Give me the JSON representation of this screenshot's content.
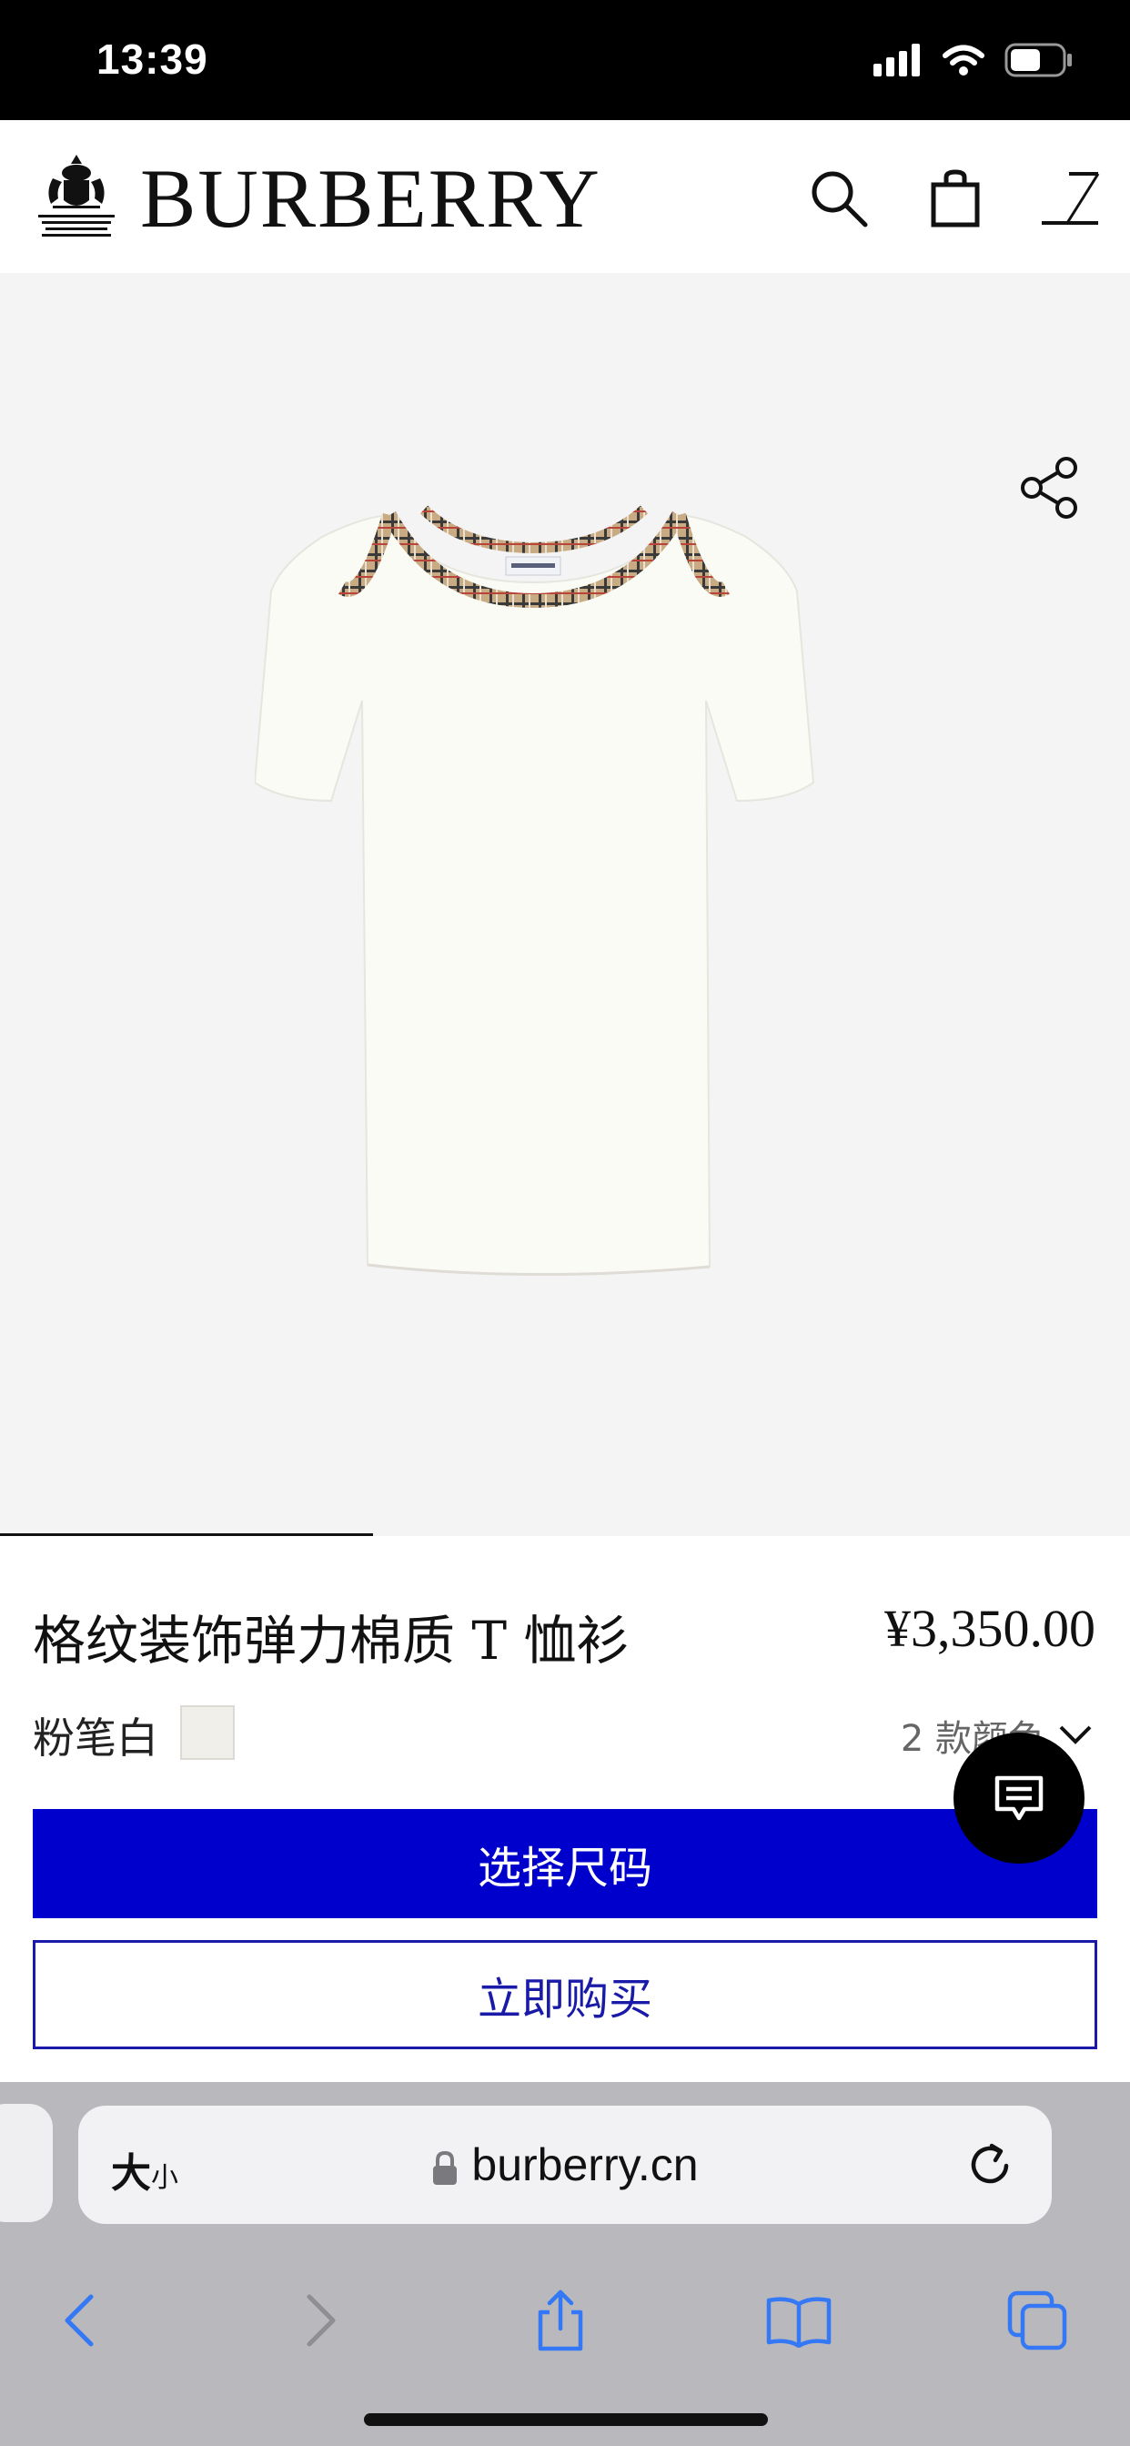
{
  "status_bar": {
    "time": "13:39"
  },
  "header": {
    "brand": "BURBERRY"
  },
  "product": {
    "title": "格纹装饰弹力棉质 T 恤衫",
    "price": "¥3,350.00",
    "color_name": "粉笔白",
    "colors_count_label": "2 款颜色",
    "image_position": 0.33
  },
  "actions": {
    "select_size": "选择尺码",
    "buy_now": "立即购买"
  },
  "safari": {
    "text_size_large": "大",
    "text_size_small": "小",
    "url": "burberry.cn"
  },
  "colors": {
    "primary_button": "#0000cc",
    "secondary_border": "#1a1aa8",
    "safari_tint": "#3478f6",
    "swatch": "#f1efea"
  }
}
